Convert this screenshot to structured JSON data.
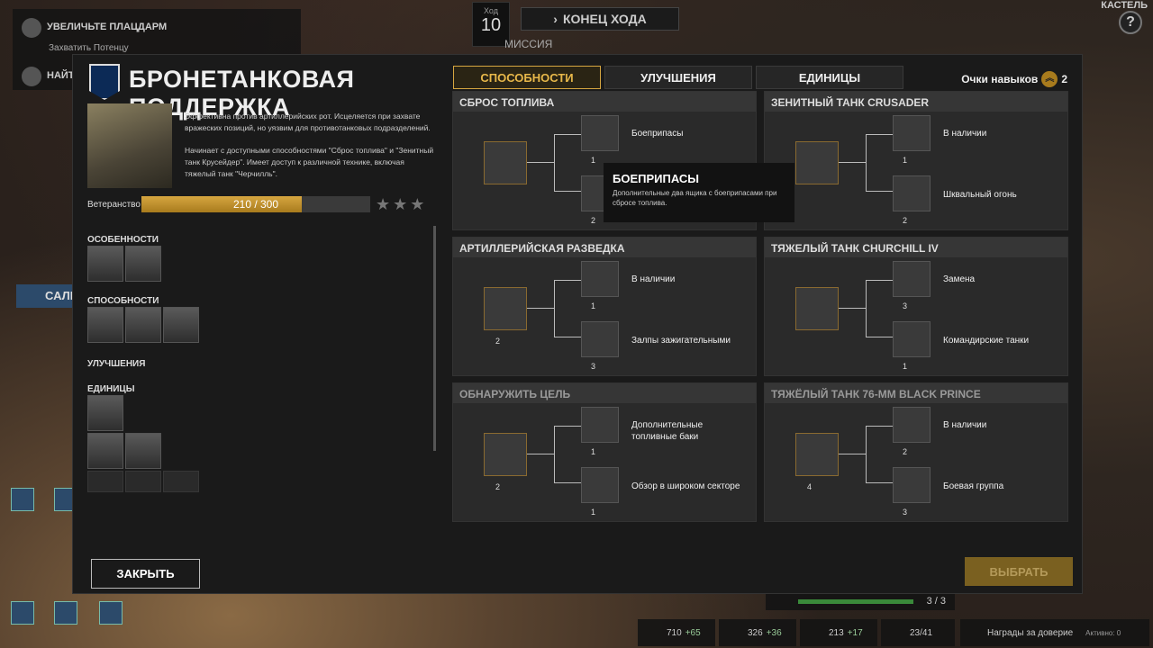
{
  "hud": {
    "objective1": "УВЕЛИЧЬТЕ ПЛАЦДАРМ",
    "objective2": "Захватить Потенцу",
    "objective3": "НАЙТИ",
    "turn_label": "Ход",
    "turn_value": "10",
    "end_turn": "КОНЕЦ ХОДА",
    "mission": "МИССИЯ",
    "castle": "КАСТЕЛЬ",
    "sale": "САЛЕ",
    "help": "?",
    "dispatch": "3 / 3"
  },
  "resources": [
    {
      "value": "710",
      "delta": "+65"
    },
    {
      "value": "326",
      "delta": "+36"
    },
    {
      "value": "213",
      "delta": "+17"
    },
    {
      "value": "23/41",
      "delta": ""
    }
  ],
  "trust": {
    "label": "Награды за доверие",
    "active": "Активно: 0"
  },
  "panel": {
    "title": "БРОНЕТАНКОВАЯ ПОДДЕРЖКА",
    "desc1": "Эффективна против артиллерийских рот. Исцеляется при захвате вражеских позиций, но уязвим для противотанковых подразделений.",
    "desc2": "Начинает с доступными способностями \"Сброс топлива\" и \"Зенитный танк Крусейдер\". Имеет доступ к различной технике, включая тяжелый танк \"Черчилль\".",
    "veterancy_label": "Ветеранство",
    "veterancy_text": "210 / 300",
    "veterancy_fraction": 0.7,
    "sections": {
      "traits": "ОСОБЕННОСТИ",
      "abilities": "СПОСОБНОСТИ",
      "upgrades": "УЛУЧШЕНИЯ",
      "units": "ЕДИНИЦЫ"
    },
    "close": "ЗАКРЫТЬ",
    "choose": "ВЫБРАТЬ"
  },
  "tabs": [
    "СПОСОБНОСТИ",
    "УЛУЧШЕНИЯ",
    "ЕДИНИЦЫ"
  ],
  "skill_points": {
    "label": "Очки навыков",
    "value": "2"
  },
  "cards": [
    {
      "title": "СБРОС ТОПЛИВА",
      "main_cost": "",
      "top_label": "Боеприпасы",
      "top_cost": "1",
      "bot_label": "",
      "bot_cost": "2"
    },
    {
      "title": "ЗЕНИТНЫЙ ТАНК CRUSADER",
      "main_cost": "",
      "top_label": "В наличии",
      "top_cost": "1",
      "bot_label": "Шквальный огонь",
      "bot_cost": "2"
    },
    {
      "title": "АРТИЛЛЕРИЙСКАЯ РАЗВЕДКА",
      "main_cost": "2",
      "top_label": "В наличии",
      "top_cost": "1",
      "bot_label": "Залпы зажигательными",
      "bot_cost": "3"
    },
    {
      "title": "ТЯЖЕЛЫЙ ТАНК CHURCHILL IV",
      "main_cost": "",
      "top_label": "Замена",
      "top_cost": "3",
      "bot_label": "Командирские танки",
      "bot_cost": "1"
    },
    {
      "title": "ОБНАРУЖИТЬ ЦЕЛЬ",
      "main_cost": "2",
      "top_label": "Дополнительные топливные баки",
      "top_cost": "1",
      "bot_label": "Обзор в широком секторе",
      "bot_cost": "1"
    },
    {
      "title": "ТЯЖЁЛЫЙ ТАНК 76-MM BLACK PRINCE",
      "main_cost": "4",
      "top_label": "В наличии",
      "top_cost": "2",
      "bot_label": "Боевая группа",
      "bot_cost": "3"
    }
  ],
  "tooltip": {
    "title": "БОЕПРИПАСЫ",
    "desc": "Дополнительные два ящика с боеприпасами при сбросе топлива."
  }
}
